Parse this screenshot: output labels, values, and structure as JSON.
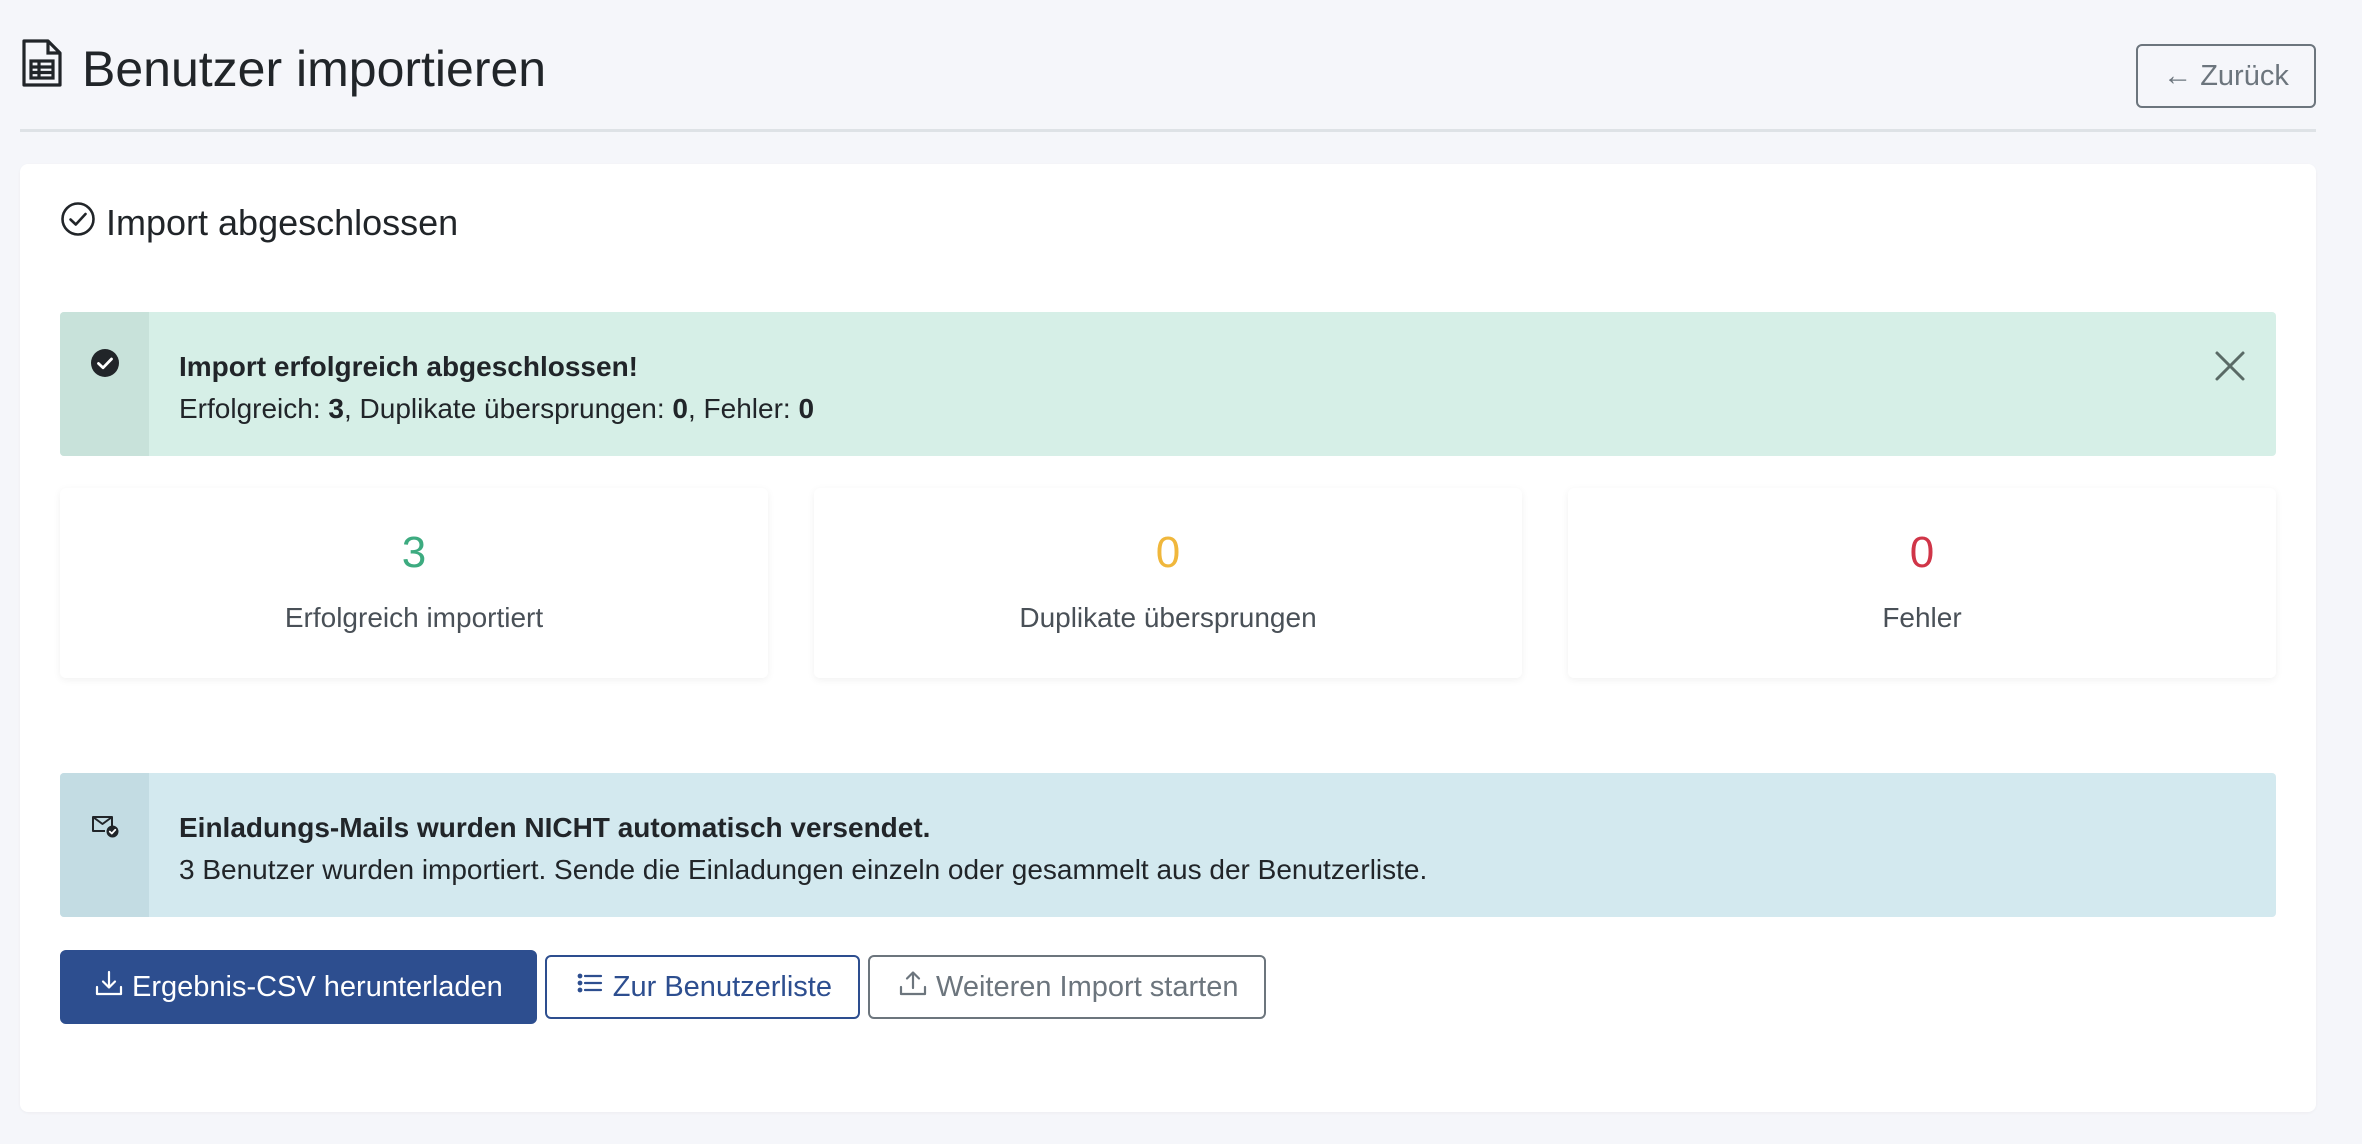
{
  "header": {
    "title": "Benutzer importieren",
    "back_label": "← Zurück"
  },
  "card": {
    "title": "Import abgeschlossen"
  },
  "success_alert": {
    "heading": "Import erfolgreich abgeschlossen!",
    "success_label": "Erfolgreich: ",
    "success_count": "3",
    "duplicates_label": ", Duplikate übersprungen: ",
    "duplicates_count": "0",
    "errors_label": ", Fehler: ",
    "errors_count": "0"
  },
  "stats": [
    {
      "value": "3",
      "label": "Erfolgreich importiert",
      "color": "#3dab80"
    },
    {
      "value": "0",
      "label": "Duplikate übersprungen",
      "color": "#f0b73c"
    },
    {
      "value": "0",
      "label": "Fehler",
      "color": "#d03548"
    }
  ],
  "info_alert": {
    "heading": "Einladungs-Mails wurden NICHT automatisch versendet.",
    "text": "3 Benutzer wurden importiert. Sende die Einladungen einzeln oder gesammelt aus der Benutzerliste."
  },
  "actions": {
    "download_label": "Ergebnis-CSV herunterladen",
    "user_list_label": "Zur Benutzerliste",
    "new_import_label": "Weiteren Import starten"
  },
  "icons": {
    "title": "file-spreadsheet-icon",
    "card": "check-circle-icon",
    "success": "check-circle-fill-icon",
    "close": "close-icon",
    "info": "envelope-check-icon",
    "download": "download-icon",
    "list": "list-icon",
    "upload": "upload-icon"
  },
  "colors": {
    "primary": "#2d4e8f",
    "success_bg": "#d6efe7",
    "info_bg": "#d3e9ef"
  }
}
